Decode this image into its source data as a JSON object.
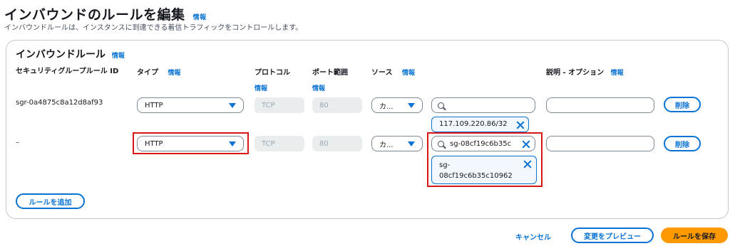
{
  "page": {
    "title": "インバウンドのルールを編集",
    "info": "情報",
    "subtitle": "インバウンドルールは、インスタンスに到達できる着信トラフィックをコントロールします。"
  },
  "section": {
    "title": "インバウンドルール",
    "info": "情報"
  },
  "columns": {
    "rule_id": "セキュリティグループルール ID",
    "type": "タイプ",
    "type_info": "情報",
    "protocol": "プロトコル",
    "protocol_info": "情報",
    "port": "ポート範囲",
    "port_info": "情報",
    "source": "ソース",
    "source_info": "情報",
    "description": "説明 - オプション",
    "description_info": "情報"
  },
  "rows": [
    {
      "rule_id": "sgr-0a4875c8a12d8af93",
      "type": "HTTP",
      "protocol": "TCP",
      "port": "80",
      "source_type": "カ...",
      "search_value": "",
      "token": "117.109.220.86/32",
      "description": "",
      "delete_label": "削除"
    },
    {
      "rule_id": "–",
      "type": "HTTP",
      "protocol": "TCP",
      "port": "80",
      "source_type": "カ...",
      "search_value": "sg-08cf19c6b35c",
      "token_line1": "sg-",
      "token_line2": "08cf19c6b35c10962",
      "description": "",
      "delete_label": "削除"
    }
  ],
  "add_rule_label": "ルールを追加",
  "footer": {
    "cancel": "キャンセル",
    "preview": "変更をプレビュー",
    "save": "ルールを保存"
  },
  "colors": {
    "accent": "#0972d3",
    "primary_button": "#ff9900",
    "highlight": "#d91515"
  }
}
